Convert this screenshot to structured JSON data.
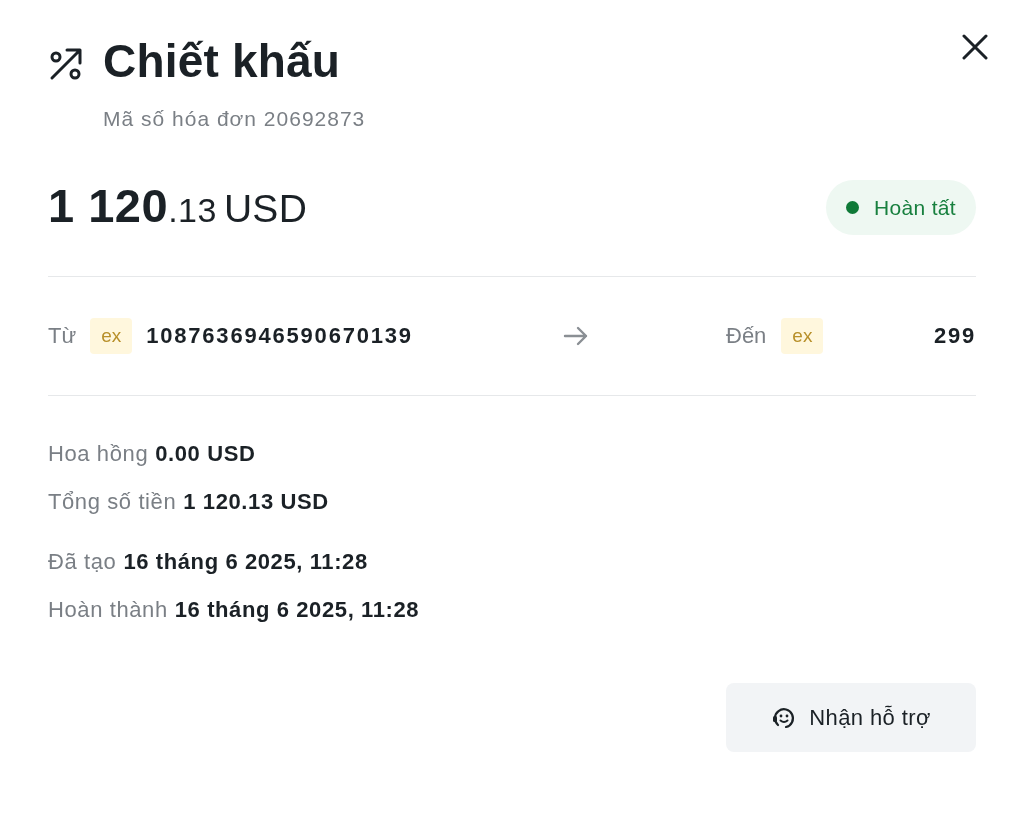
{
  "header": {
    "title": "Chiết khấu",
    "invoice": "Mã số hóa đơn 20692873"
  },
  "amount": {
    "integer": "1 120",
    "fraction": ".13",
    "currency": "USD"
  },
  "status": {
    "label": "Hoàn tất",
    "kind": "completed"
  },
  "transfer": {
    "from": {
      "label": "Từ",
      "badge": "ex",
      "account": "1087636946590670139"
    },
    "to": {
      "label": "Đến",
      "badge": "ex",
      "account": "299"
    }
  },
  "detail_groups": [
    [
      {
        "label": "Hoa hồng",
        "value": "0.00 USD"
      },
      {
        "label": "Tổng số tiền",
        "value": "1 120.13 USD"
      }
    ],
    [
      {
        "label": "Đã tạo",
        "value": "16 tháng 6 2025, 11:28"
      },
      {
        "label": "Hoàn thành",
        "value": "16 tháng 6 2025, 11:28"
      }
    ]
  ],
  "support_button": {
    "label": "Nhận hỗ trợ"
  }
}
